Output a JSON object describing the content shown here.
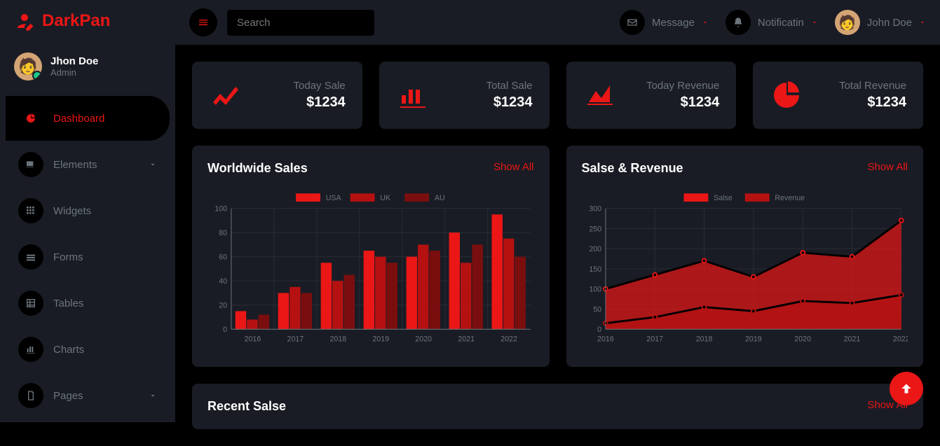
{
  "brand": "DarkPan",
  "user": {
    "name": "Jhon Doe",
    "role": "Admin"
  },
  "topbar": {
    "search_placeholder": "Search",
    "message": "Message",
    "notification": "Notificatin",
    "user": "John Doe"
  },
  "nav": [
    {
      "label": "Dashboard",
      "active": true
    },
    {
      "label": "Elements",
      "expandable": true
    },
    {
      "label": "Widgets"
    },
    {
      "label": "Forms"
    },
    {
      "label": "Tables"
    },
    {
      "label": "Charts"
    },
    {
      "label": "Pages",
      "expandable": true
    }
  ],
  "cards": [
    {
      "label": "Today Sale",
      "value": "$1234"
    },
    {
      "label": "Total Sale",
      "value": "$1234"
    },
    {
      "label": "Today Revenue",
      "value": "$1234"
    },
    {
      "label": "Total Revenue",
      "value": "$1234"
    }
  ],
  "charts": {
    "worldwide": {
      "title": "Worldwide Sales",
      "link": "Show All"
    },
    "salerev": {
      "title": "Salse & Revenue",
      "link": "Show All"
    }
  },
  "recent": {
    "title": "Recent Salse",
    "link": "Show All"
  },
  "chart_data": [
    {
      "type": "bar",
      "title": "Worldwide Sales",
      "categories": [
        "2016",
        "2017",
        "2018",
        "2019",
        "2020",
        "2021",
        "2022"
      ],
      "series": [
        {
          "name": "USA",
          "values": [
            15,
            30,
            55,
            65,
            60,
            80,
            95
          ]
        },
        {
          "name": "UK",
          "values": [
            8,
            35,
            40,
            60,
            70,
            55,
            75
          ]
        },
        {
          "name": "AU",
          "values": [
            12,
            30,
            45,
            55,
            65,
            70,
            60
          ]
        }
      ],
      "ylim": [
        0,
        100
      ],
      "legend_colors": [
        "#eb1616",
        "#b51111",
        "#7a0e0e"
      ]
    },
    {
      "type": "area",
      "title": "Salse & Revenue",
      "x": [
        "2016",
        "2017",
        "2018",
        "2019",
        "2020",
        "2021",
        "2022"
      ],
      "series": [
        {
          "name": "Salse",
          "values": [
            100,
            135,
            170,
            130,
            190,
            180,
            270
          ]
        },
        {
          "name": "Revenue",
          "values": [
            15,
            30,
            55,
            45,
            70,
            65,
            85
          ]
        }
      ],
      "ylim": [
        0,
        300
      ],
      "legend_colors": [
        "#eb1616",
        "#b51111"
      ]
    }
  ]
}
